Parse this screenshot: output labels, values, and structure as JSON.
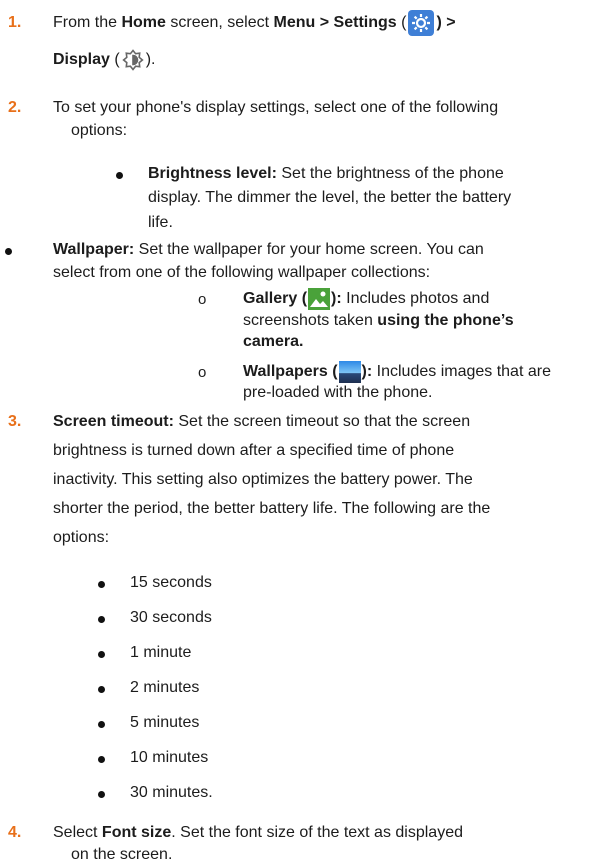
{
  "step1": {
    "number": "1.",
    "t1": "From the ",
    "home": "Home",
    "t2": " screen, select ",
    "menu": "Menu > Settings",
    "t3": " (",
    "t4": ") >",
    "display": "Display",
    "t5": " (",
    "t6": ")."
  },
  "step2": {
    "number": "2.",
    "line1": "To set your phone's display settings, select one of the following",
    "line2": "options:"
  },
  "brightness": {
    "label": "Brightness level:",
    "line1": " Set the brightness of the phone",
    "line2": "display. The dimmer the level, the better the battery",
    "line3": "life."
  },
  "wallpaper": {
    "label": "Wallpaper:",
    "line1": " Set the wallpaper for your home screen. You can",
    "line2": "select from one of the following wallpaper collections:",
    "bullet_char": "o",
    "gallery_label": "Gallery (",
    "gallery_close": "):",
    "gallery_line1": " Includes photos and",
    "gallery_line2": "screenshots taken ",
    "gallery_bold2": "using the phone’s",
    "gallery_bold3": "camera.",
    "wallpapers_label": "Wallpapers (",
    "wallpapers_close": "):",
    "wallpapers_line1": " Includes images that are",
    "wallpapers_line2": "pre-loaded with the phone."
  },
  "step3": {
    "number": "3.",
    "label": "Screen timeout:",
    "line1": " Set the screen timeout so that the screen",
    "line2": "brightness is turned down after a specified time of phone",
    "line3": "inactivity. This setting also optimizes the battery power. The",
    "line4": "shorter the period, the better battery life. The following are the",
    "line5": "options:",
    "options": [
      "15 seconds",
      "30 seconds",
      "1 minute",
      "2 minutes",
      "5 minutes",
      "10 minutes",
      "30 minutes."
    ]
  },
  "step4": {
    "number": "4.",
    "t1": "Select ",
    "label": "Font size",
    "t2": ". Set the font size of the text as displayed",
    "line2": "on the screen."
  },
  "icons": [
    "settings-gear-icon",
    "display-brightness-icon",
    "gallery-icon",
    "wallpapers-icon"
  ]
}
